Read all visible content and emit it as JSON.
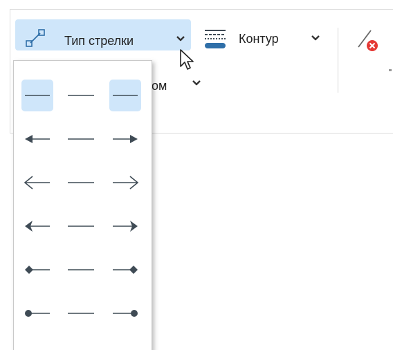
{
  "toolbar": {
    "arrow_type_label": "Тип стрелки",
    "contour_label": "Контур",
    "partial_label": "ом"
  },
  "arrow_menu": {
    "rows": [
      {
        "name": "no-arrows",
        "start": "none",
        "end": "none",
        "selected_start": true,
        "selected_end": true
      },
      {
        "name": "filled-arrows",
        "start": "filled-arrow",
        "end": "filled-arrow"
      },
      {
        "name": "open-arrows",
        "start": "open-arrow",
        "end": "open-arrow"
      },
      {
        "name": "stealth-arrows",
        "start": "stealth-arrow",
        "end": "stealth-arrow"
      },
      {
        "name": "diamond-arrows",
        "start": "diamond",
        "end": "diamond"
      },
      {
        "name": "oval-arrows",
        "start": "oval",
        "end": "oval"
      }
    ]
  },
  "colors": {
    "accent_bg": "#cfe6fa",
    "icon_blue": "#2f6fa8",
    "glyph_dark": "#3f4b55",
    "delete_red": "#e53935"
  }
}
